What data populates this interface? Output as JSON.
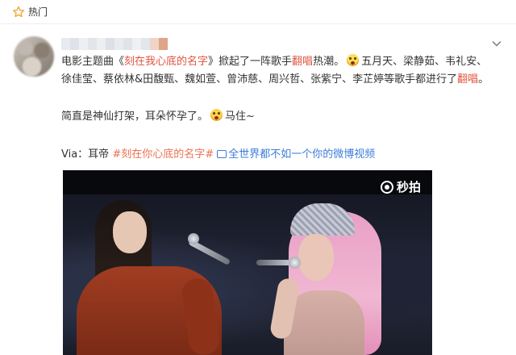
{
  "section": {
    "label": "热门",
    "icon": "star-outline-icon"
  },
  "user": {
    "name": ""
  },
  "post": {
    "line1": {
      "a": "电影主题曲《",
      "b": "刻在我心底的名字",
      "c": "》掀起了一阵歌手",
      "d": "翻唱",
      "e": "热潮。",
      "f": "五月天、梁静茹、韦礼安、"
    },
    "line2": {
      "a": "徐佳莹、蔡依林&田馥甄、魏如萱、曾沛慈、周兴哲、张紫宁、李芷婷等歌手都进行了",
      "b": "翻唱",
      "c": "。"
    },
    "line3": {
      "a": "简直是神仙打架，耳朵怀孕了。",
      "b": "马住~"
    },
    "line4": {
      "via": "Via：耳帝 ",
      "topic": "#刻在你心底的名字#",
      "video_link": "全世界都不如一个你的微博视频"
    }
  },
  "video": {
    "watermark": "秒拍"
  },
  "colors": {
    "accent_red": "#e0533f",
    "link_orange": "#eb7350",
    "link_blue": "#3d7cd8"
  }
}
